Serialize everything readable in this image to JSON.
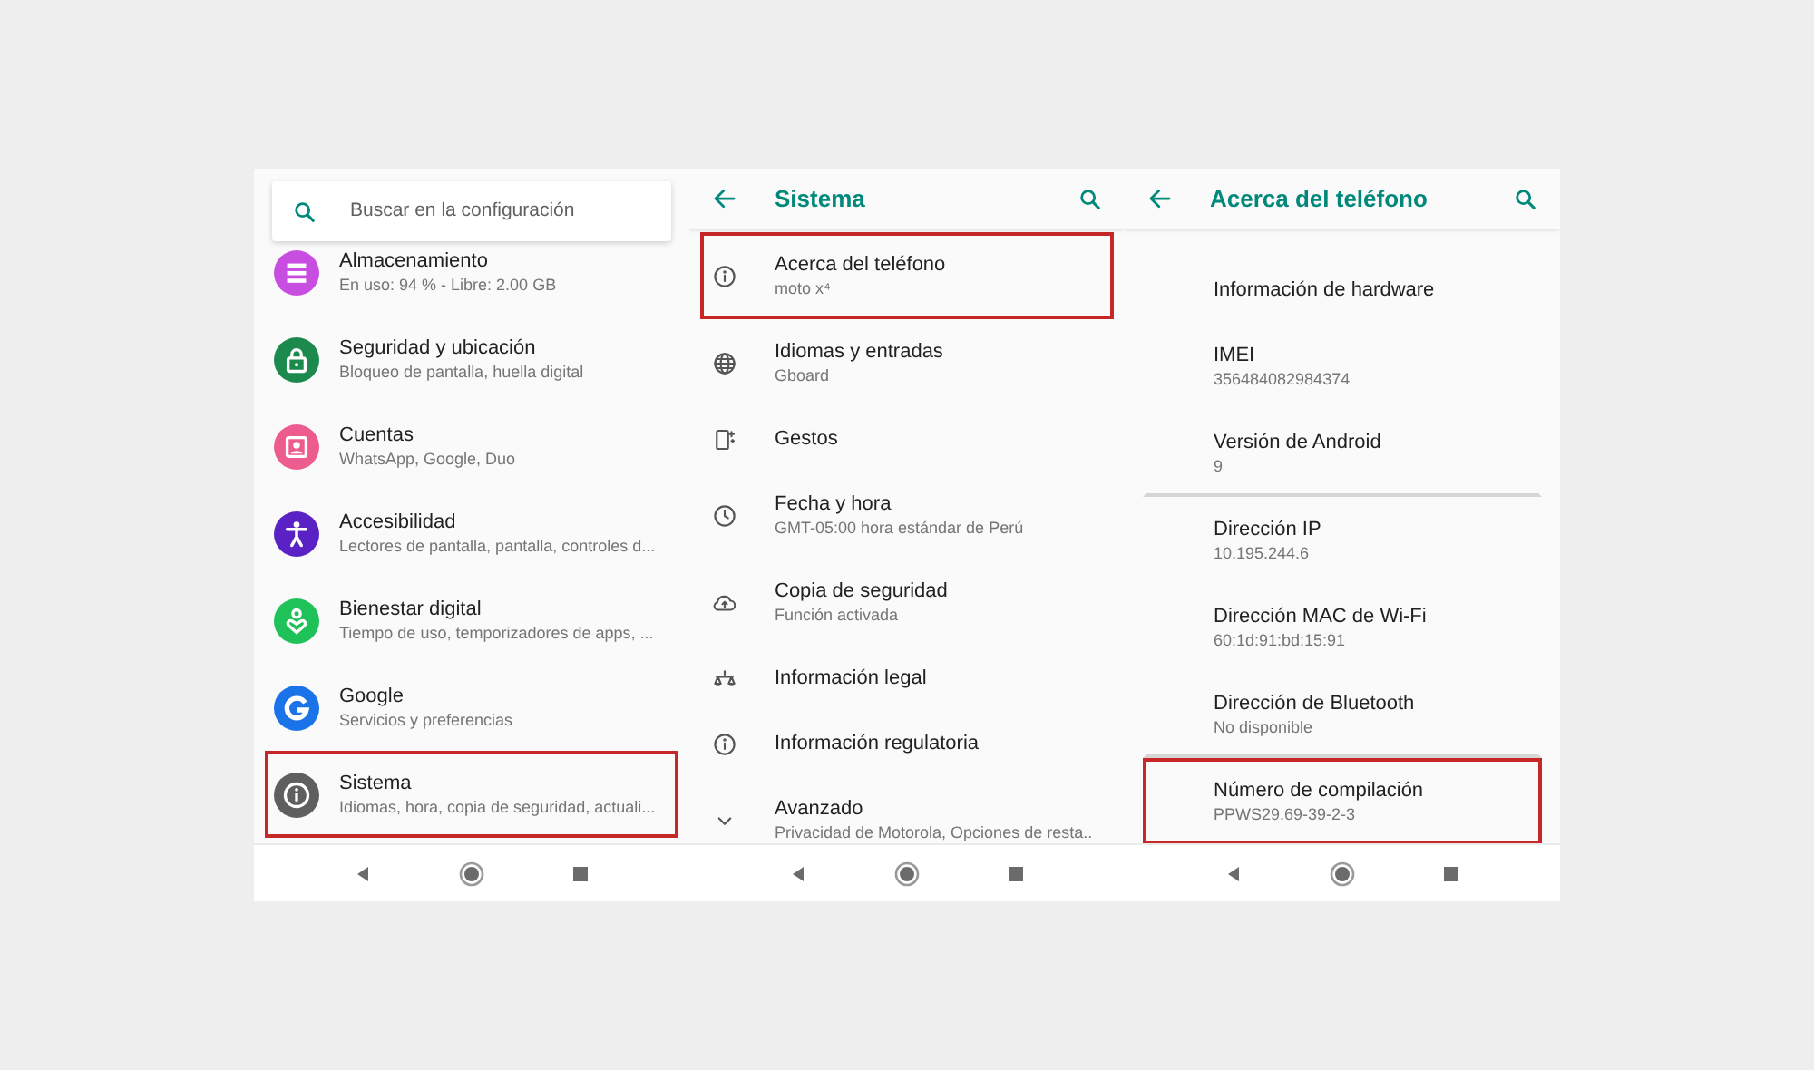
{
  "panels": [
    {
      "kind": "main",
      "search": {
        "placeholder": "Buscar en la configuración"
      },
      "items": [
        {
          "title": "Almacenamiento",
          "subtitle": "En uso: 94 % - Libre: 2.00 GB",
          "color": "#c74ee0",
          "highlighted": false
        },
        {
          "title": "Seguridad y ubicación",
          "subtitle": "Bloqueo de pantalla, huella digital",
          "color": "#1b8a4c",
          "highlighted": false
        },
        {
          "title": "Cuentas",
          "subtitle": "WhatsApp, Google, Duo",
          "color": "#ec5c8e",
          "highlighted": false
        },
        {
          "title": "Accesibilidad",
          "subtitle": "Lectores de pantalla, pantalla, controles d...",
          "color": "#5a22c4",
          "highlighted": false
        },
        {
          "title": "Bienestar digital",
          "subtitle": "Tiempo de uso, temporizadores de apps, ...",
          "color": "#1fc259",
          "highlighted": false
        },
        {
          "title": "Google",
          "subtitle": "Servicios y preferencias",
          "color": "#1a73e8",
          "highlighted": false
        },
        {
          "title": "Sistema",
          "subtitle": "Idiomas, hora, copia de seguridad, actuali...",
          "color": "#5f5f5f",
          "highlighted": true
        }
      ]
    },
    {
      "kind": "sub",
      "title": "Sistema",
      "items": [
        {
          "title": "Acerca del teléfono",
          "subtitle": "moto x⁴",
          "highlighted": true
        },
        {
          "title": "Idiomas y entradas",
          "subtitle": "Gboard",
          "highlighted": false
        },
        {
          "title": "Gestos",
          "highlighted": false
        },
        {
          "title": "Fecha y hora",
          "subtitle": "GMT-05:00 hora estándar de Perú",
          "highlighted": false
        },
        {
          "title": "Copia de seguridad",
          "subtitle": "Función activada",
          "highlighted": false
        },
        {
          "title": "Información legal",
          "highlighted": false
        },
        {
          "title": "Información regulatoria",
          "highlighted": false
        },
        {
          "title": "Avanzado",
          "subtitle": "Privacidad de Motorola, Opciones de resta..",
          "highlighted": false
        }
      ]
    },
    {
      "kind": "sub",
      "title": "Acerca del teléfono",
      "items": [
        {
          "title": "Información de hardware",
          "highlighted": false,
          "divider_after": false
        },
        {
          "title": "IMEI",
          "subtitle": "356484082984374",
          "highlighted": false,
          "divider_after": false
        },
        {
          "title": "Versión de Android",
          "subtitle": "9",
          "highlighted": false,
          "divider_after": true
        },
        {
          "title": "Dirección IP",
          "subtitle": "10.195.244.6",
          "highlighted": false,
          "divider_after": false
        },
        {
          "title": "Dirección MAC de Wi-Fi",
          "subtitle": "60:1d:91:bd:15:91",
          "highlighted": false,
          "divider_after": false
        },
        {
          "title": "Dirección de Bluetooth",
          "subtitle": "No disponible",
          "highlighted": false,
          "divider_after": true
        },
        {
          "title": "Número de compilación",
          "subtitle": "PPWS29.69-39-2-3",
          "highlighted": true,
          "divider_after": false
        }
      ]
    }
  ]
}
